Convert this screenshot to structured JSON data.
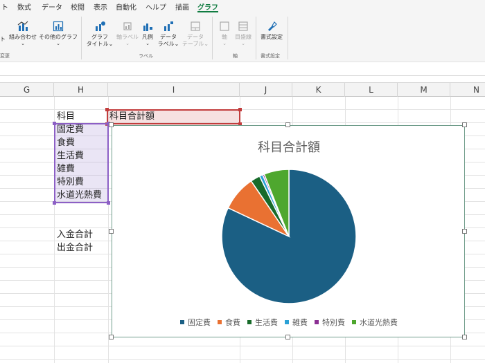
{
  "menu": {
    "tabs": [
      {
        "label": "ト",
        "active": false
      },
      {
        "label": "数式",
        "active": false
      },
      {
        "label": "データ",
        "active": false
      },
      {
        "label": "校閲",
        "active": false
      },
      {
        "label": "表示",
        "active": false
      },
      {
        "label": "自動化",
        "active": false
      },
      {
        "label": "ヘルプ",
        "active": false
      },
      {
        "label": "描画",
        "active": false
      },
      {
        "label": "グラフ",
        "active": true
      }
    ]
  },
  "ribbon": {
    "partial_left_label": "ト",
    "combo_label": "組み合わせ",
    "other_chart_label": "その他のグラフ",
    "change_group_partial": "変更",
    "chart_title_label_1": "グラフ",
    "chart_title_label_2": "タイトル",
    "axis_labels_label": "軸ラベル",
    "legend_label": "凡例",
    "data_labels_label_1": "データ",
    "data_labels_label_2": "ラベル",
    "data_table_label_1": "データ",
    "data_table_label_2": "テーブル",
    "labels_group": "ラベル",
    "axes_label": "軸",
    "gridlines_label": "目盛線",
    "axes_group": "軸",
    "format_label": "書式設定",
    "format_group": "書式設定"
  },
  "columns": [
    "G",
    "H",
    "I",
    "J",
    "K",
    "L",
    "M",
    "N"
  ],
  "cells": {
    "h1": "科目",
    "i1": "科目合計額",
    "h2": "固定費",
    "h3": "食費",
    "h4": "生活費",
    "h5": "雑費",
    "h6": "特別費",
    "h7": "水道光熱費",
    "h10": "入金合計",
    "h11": "出金合計"
  },
  "chart_data": {
    "type": "pie",
    "title": "科目合計額",
    "categories": [
      "固定費",
      "食費",
      "生活費",
      "雑費",
      "特別費",
      "水道光熱費"
    ],
    "values": [
      82.0,
      8.5,
      2.3,
      0.8,
      0.4,
      6.0
    ],
    "colors": [
      "#1b5f84",
      "#e97132",
      "#176b2a",
      "#2aa1d6",
      "#8b2f93",
      "#4ea72e"
    ],
    "legend_position": "bottom"
  }
}
